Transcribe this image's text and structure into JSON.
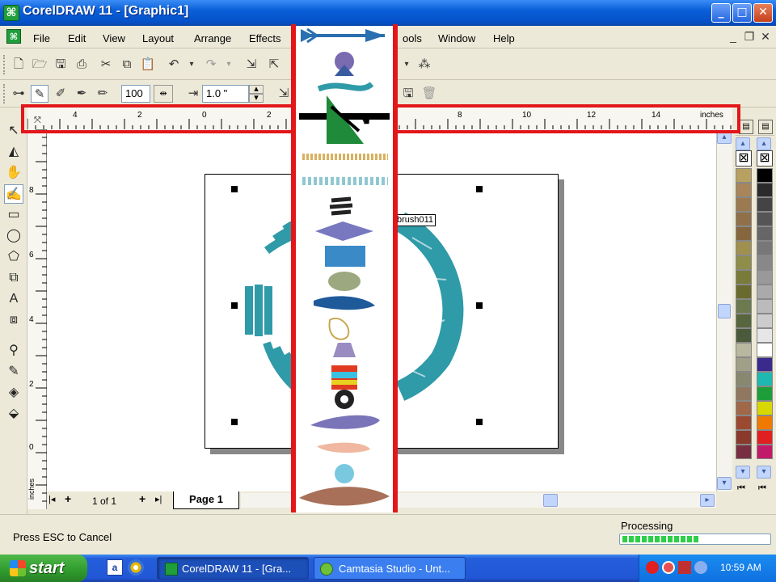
{
  "window": {
    "title": "CorelDRAW 11 - [Graphic1]",
    "app_icon_glyph": "⌘",
    "min": "_",
    "max": "□",
    "close": "✕"
  },
  "menu": {
    "items": [
      "File",
      "Edit",
      "View",
      "Layout",
      "Arrange",
      "Effects",
      "ools",
      "Window",
      "Help"
    ],
    "mdi_min": "_",
    "mdi_restore": "❐",
    "mdi_close": "✕"
  },
  "property_bar": {
    "smoothing_value": "100",
    "width_value": "1.0 \""
  },
  "ruler": {
    "unit": "inches",
    "h_ticks": [
      "4",
      "2",
      "0",
      "2",
      "8",
      "10",
      "12",
      "14"
    ],
    "v_ticks": [
      "8",
      "6",
      "4",
      "2",
      "0"
    ],
    "v_unit": "inches"
  },
  "canvas": {
    "brush_label": "brush011"
  },
  "page_nav": {
    "first": "|◂",
    "add_before": "+",
    "page_count": "1 of 1",
    "add_after": "+",
    "last": "▸|",
    "tab": "Page 1"
  },
  "status": {
    "message": "Press ESC to Cancel",
    "processing_label": "Processing"
  },
  "taskbar": {
    "start": "start",
    "tasks": [
      "CorelDRAW 11 - [Gra...",
      "Camtasia Studio - Unt..."
    ],
    "clock": "10:59 AM"
  },
  "palette": {
    "colors": [
      "#000000",
      "#2b2b2b",
      "#444444",
      "#555555",
      "#666666",
      "#777777",
      "#888888",
      "#999999",
      "#aaaaaa",
      "#bbbbbb",
      "#cccccc",
      "#e6e6e6",
      "#ffffff",
      "#3a2a8c",
      "#1fb8b0",
      "#1e9e3a",
      "#d8d800",
      "#f07a00",
      "#e02020",
      "#c21a6a"
    ],
    "left_colors": [
      "#b8a060",
      "#a8865a",
      "#9c7a50",
      "#907048",
      "#86663f",
      "#a09050",
      "#8e8e4a",
      "#7a7a3a",
      "#6a6a2e",
      "#6c7a50",
      "#58663e",
      "#4a5a3a",
      "#b8b8a0",
      "#a0a088",
      "#888870",
      "#907860",
      "#a06848",
      "#9a4a30",
      "#8a3a2a",
      "#783040"
    ]
  },
  "colors": {
    "accent_red": "#e3161a",
    "brush_teal": "#2f9aa8"
  }
}
